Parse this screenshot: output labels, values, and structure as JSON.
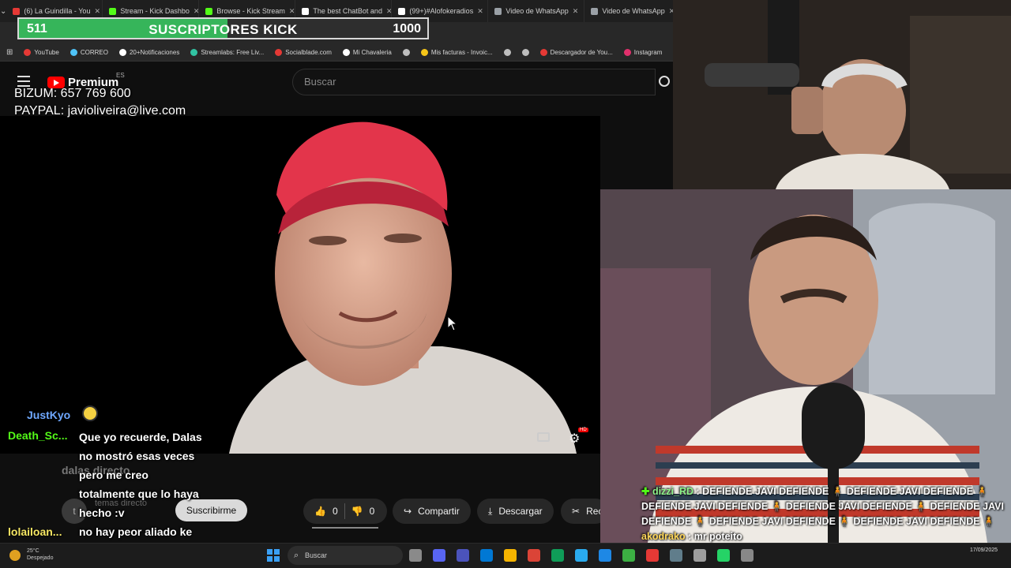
{
  "browser": {
    "tabs": [
      {
        "label": "(6) La Guindilla - You",
        "color": "#e53935"
      },
      {
        "label": "Stream - Kick Dashbo",
        "color": "#53fc18"
      },
      {
        "label": "Browse - Kick Stream",
        "color": "#53fc18"
      },
      {
        "label": "The best ChatBot and",
        "color": "#ffffff"
      },
      {
        "label": "(99+)#Alofokeradios",
        "color": "#ffffff"
      },
      {
        "label": "Video de WhatsApp",
        "color": "#9aa0a6"
      },
      {
        "label": "Video de WhatsApp",
        "color": "#9aa0a6"
      }
    ],
    "bookmarks": [
      {
        "label": "YouTube",
        "color": "#e53935"
      },
      {
        "label": "CORREO",
        "color": "#4fc3f7"
      },
      {
        "label": "20+Notificaciones",
        "color": "#ffffff"
      },
      {
        "label": "Streamlabs: Free Liv...",
        "color": "#31c3a2"
      },
      {
        "label": "Socialblade.com",
        "color": "#e53935"
      },
      {
        "label": "Mi Chavaleria",
        "color": "#ffffff"
      },
      {
        "label": "",
        "color": "#bdbdbd"
      },
      {
        "label": "Mis facturas - Invoic...",
        "color": "#f5c518"
      },
      {
        "label": "",
        "color": "#bdbdbd"
      },
      {
        "label": "",
        "color": "#bdbdbd"
      },
      {
        "label": "Descargador de You...",
        "color": "#e53935"
      },
      {
        "label": "Instagram",
        "color": "#e1306c"
      }
    ]
  },
  "subscriber_goal": {
    "current": "511",
    "title": "SUSCRIPTORES KICK",
    "goal": "1000",
    "progress": 0.511
  },
  "donations": {
    "bizum": "BIZUM: 657 769 600",
    "paypal": "PAYPAL: javioliveira@live.com"
  },
  "youtube": {
    "logo": "Premium",
    "region": "ES",
    "search_placeholder": "Buscar",
    "channel_name": "dalas directo",
    "channel_subs": "temas directo",
    "avatar_letter": "t",
    "subscribe": "Suscribirme",
    "likes": "0",
    "dislikes": "0",
    "share": "Compartir",
    "download": "Descargar",
    "clip": "Rec"
  },
  "chat_left": {
    "users": [
      {
        "name": "JustKyo",
        "color": "#6fa8ff"
      },
      {
        "name": "Death_Sc...",
        "color": "#53fc18"
      },
      {
        "name": "lolailoan...",
        "color": "#f5e663"
      }
    ],
    "message_lines": [
      "Que yo recuerde, Dalas",
      "no mostró esas veces",
      "pero me creo",
      "totalmente que lo haya",
      "hecho :v",
      "no hay peor aliado ke",
      "un hater camuflado xd"
    ]
  },
  "chat_right": {
    "line1_user": "dizzi_RD",
    "line1_text": ": DEFIENDE JAVI DEFIENDE 🧍 DEFIENDE JAVI DEFIENDE 🧍 DEFIENDE JAVI DEFIENDE 🧍 DEFIENDE JAVI DEFIENDE 🧍 DEFIENDE JAVI DEFIENDE 🧍 DEFIENDE JAVI DEFIENDE 🧍 DEFIENDE JAVI DEFIENDE 🧍",
    "line2_user": "akodrako",
    "line2_text": ": mr poteito"
  },
  "taskbar": {
    "weather_temp": "25°C",
    "weather_desc": "Despejado",
    "search": "Buscar",
    "date": "17/09/2025",
    "icon_colors": [
      "#8a8a8a",
      "#5865f2",
      "#4b53bc",
      "#0078d4",
      "#f5b400",
      "#db4437",
      "#0f9d58",
      "#2aabee",
      "#1e88e5",
      "#3cb043",
      "#e53935",
      "#607d8b",
      "#9e9e9e",
      "#25d366",
      "#888888"
    ]
  }
}
